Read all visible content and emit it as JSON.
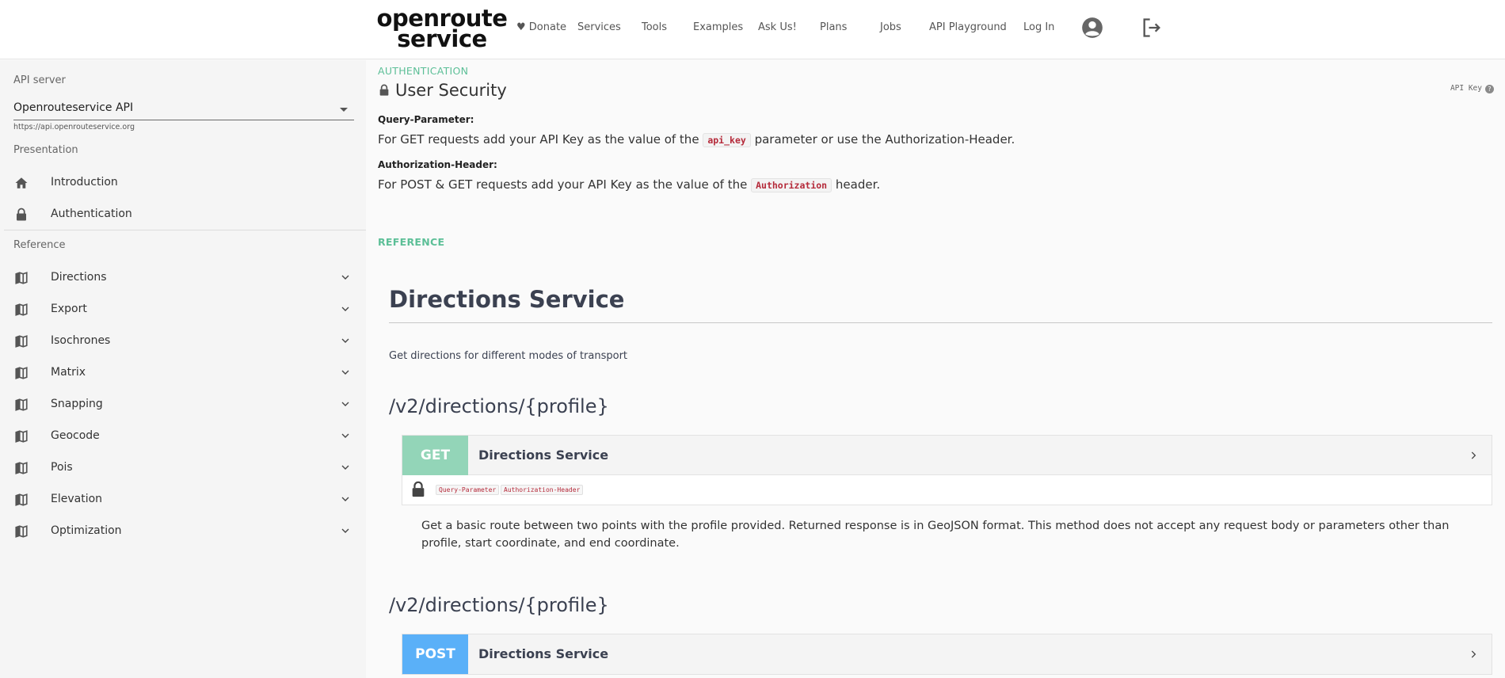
{
  "header": {
    "logo_line1": "openroute",
    "logo_line2": "service",
    "nav": [
      "♥ Donate",
      "Services",
      "Tools",
      "Examples",
      "Ask Us!",
      "Plans",
      "Jobs",
      "API Playground",
      "Log In"
    ],
    "account_icon": "account-circle-icon",
    "logout_icon": "logout-icon"
  },
  "sidebar": {
    "api_server_label": "API server",
    "server_value": "Openrouteservice API",
    "server_url": "https://api.openrouteservice.org",
    "presentation_label": "Presentation",
    "presentation_items": [
      {
        "label": "Introduction",
        "icon": "home-icon"
      },
      {
        "label": "Authentication",
        "icon": "lock-icon"
      }
    ],
    "reference_label": "Reference",
    "reference_items": [
      {
        "label": "Directions",
        "icon": "map-icon"
      },
      {
        "label": "Export",
        "icon": "map-icon"
      },
      {
        "label": "Isochrones",
        "icon": "map-icon"
      },
      {
        "label": "Matrix",
        "icon": "map-icon"
      },
      {
        "label": "Snapping",
        "icon": "map-icon"
      },
      {
        "label": "Geocode",
        "icon": "map-icon"
      },
      {
        "label": "Pois",
        "icon": "map-icon"
      },
      {
        "label": "Elevation",
        "icon": "map-icon"
      },
      {
        "label": "Optimization",
        "icon": "map-icon"
      }
    ]
  },
  "main": {
    "auth_tag": "AUTHENTICATION",
    "security_title": "User Security",
    "api_key_label": "API Key",
    "query_param_heading": "Query-Parameter:",
    "query_param_text_a": "For GET requests add your API Key as the value of the",
    "query_param_code": "api_key",
    "query_param_text_b": "parameter or use the Authorization-Header.",
    "auth_header_heading": "Authorization-Header:",
    "auth_header_text_a": "For POST & GET requests add your API Key as the value of the",
    "auth_header_code": "Authorization",
    "auth_header_text_b": "header.",
    "reference_tag": "REFERENCE",
    "service_title": "Directions Service",
    "service_desc": "Get directions for different modes of transport",
    "operations": [
      {
        "path": "/v2/directions/{profile}",
        "method": "GET",
        "method_color": "#93d5b8",
        "name": "Directions Service",
        "security": [
          "Query-Parameter",
          "Authorization-Header"
        ],
        "description": "Get a basic route between two points with the profile provided. Returned response is in GeoJSON format. This method does not accept any request body or parameters other than profile, start coordinate, and end coordinate."
      },
      {
        "path": "/v2/directions/{profile}",
        "method": "POST",
        "method_color": "#5ab0f8",
        "name": "Directions Service"
      }
    ]
  }
}
